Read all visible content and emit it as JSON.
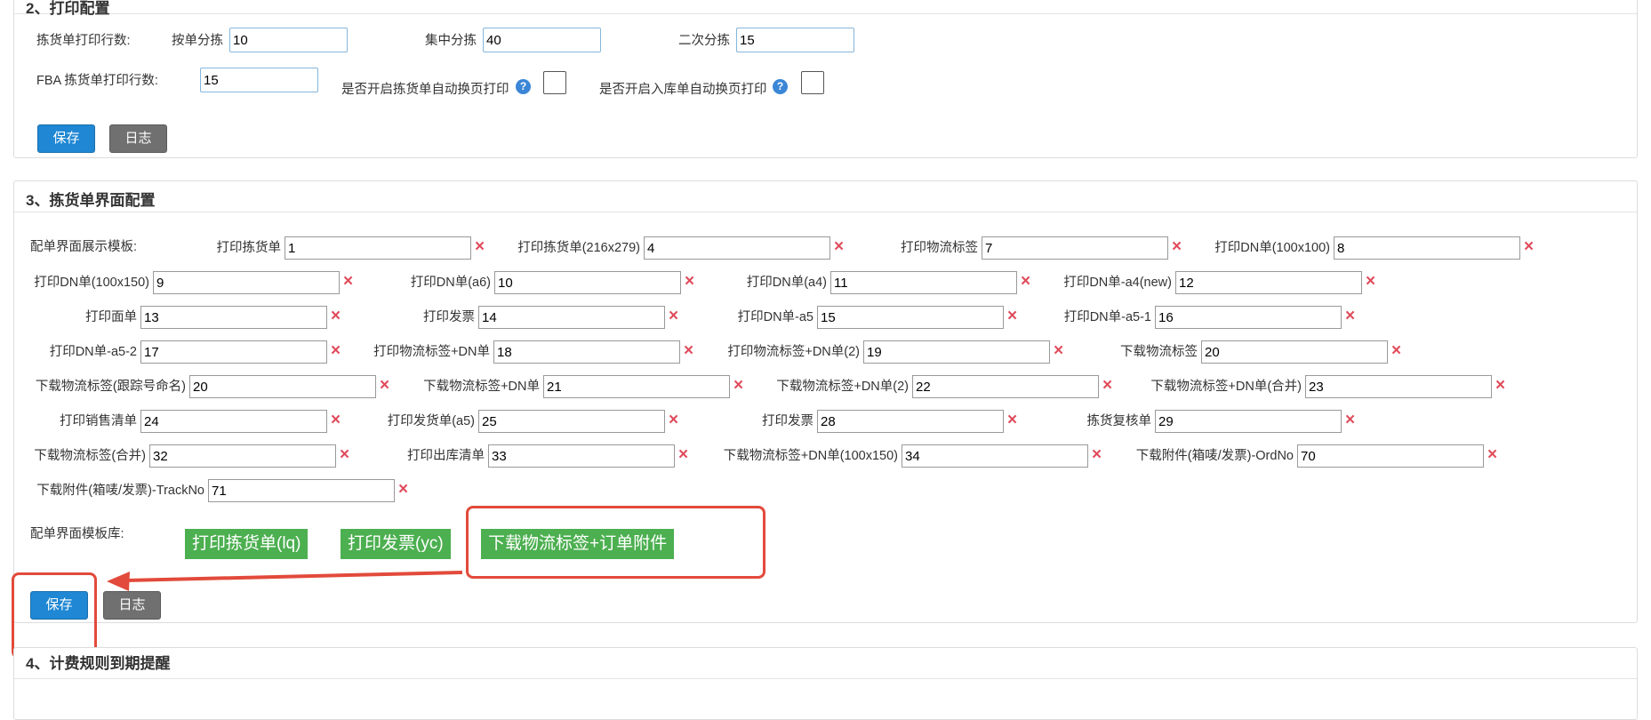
{
  "section2": {
    "title": "2、打印配置",
    "pick_rows_label": "拣货单打印行数:",
    "by_order": {
      "label": "按单分拣",
      "value": "10"
    },
    "centralized": {
      "label": "集中分拣",
      "value": "40"
    },
    "secondary": {
      "label": "二次分拣",
      "value": "15"
    },
    "fba_label": "FBA 拣货单打印行数:",
    "fba_value": "15",
    "auto_page_pick_label": "是否开启拣货单自动换页打印",
    "auto_page_stock_label": "是否开启入库单自动换页打印",
    "save": "保存",
    "log": "日志"
  },
  "section3": {
    "title": "3、拣货单界面配置",
    "template_label": "配单界面展示模板:",
    "fields": [
      {
        "label": "打印拣货单",
        "value": "1"
      },
      {
        "label": "打印拣货单(216x279)",
        "value": "4"
      },
      {
        "label": "打印物流标签",
        "value": "7"
      },
      {
        "label": "打印DN单(100x100)",
        "value": "8"
      },
      {
        "label": "打印DN单(100x150)",
        "value": "9"
      },
      {
        "label": "打印DN单(a6)",
        "value": "10"
      },
      {
        "label": "打印DN单(a4)",
        "value": "11"
      },
      {
        "label": "打印DN单-a4(new)",
        "value": "12"
      },
      {
        "label": "打印面单",
        "value": "13"
      },
      {
        "label": "打印发票",
        "value": "14"
      },
      {
        "label": "打印DN单-a5",
        "value": "15"
      },
      {
        "label": "打印DN单-a5-1",
        "value": "16"
      },
      {
        "label": "打印DN单-a5-2",
        "value": "17"
      },
      {
        "label": "打印物流标签+DN单",
        "value": "18"
      },
      {
        "label": "打印物流标签+DN单(2)",
        "value": "19"
      },
      {
        "label": "下载物流标签",
        "value": "20"
      },
      {
        "label": "下载物流标签(跟踪号命名)",
        "value": "20"
      },
      {
        "label": "下载物流标签+DN单",
        "value": "21"
      },
      {
        "label": "下载物流标签+DN单(2)",
        "value": "22"
      },
      {
        "label": "下载物流标签+DN单(合并)",
        "value": "23"
      },
      {
        "label": "打印销售清单",
        "value": "24"
      },
      {
        "label": "打印发货单(a5)",
        "value": "25"
      },
      {
        "label": "打印发票",
        "value": "28"
      },
      {
        "label": "拣货复核单",
        "value": "29"
      },
      {
        "label": "下载物流标签(合并)",
        "value": "32"
      },
      {
        "label": "打印出库清单",
        "value": "33"
      },
      {
        "label": "下载物流标签+DN单(100x150)",
        "value": "34"
      },
      {
        "label": "下载附件(箱唛/发票)-OrdNo",
        "value": "70"
      },
      {
        "label": "下载附件(箱唛/发票)-TrackNo",
        "value": "71"
      }
    ],
    "library_label": "配单界面模板库:",
    "library": [
      "打印拣货单(lq)",
      "打印发票(yc)",
      "下载物流标签+订单附件"
    ],
    "save": "保存",
    "log": "日志"
  },
  "section4": {
    "title": "4、计费规则到期提醒"
  },
  "icons": {
    "delete": "×",
    "help": "?"
  },
  "colors": {
    "primary": "#1f87d3",
    "delete": "#e04b5b",
    "green": "#4caf50",
    "annotation": "#e24a3b"
  }
}
